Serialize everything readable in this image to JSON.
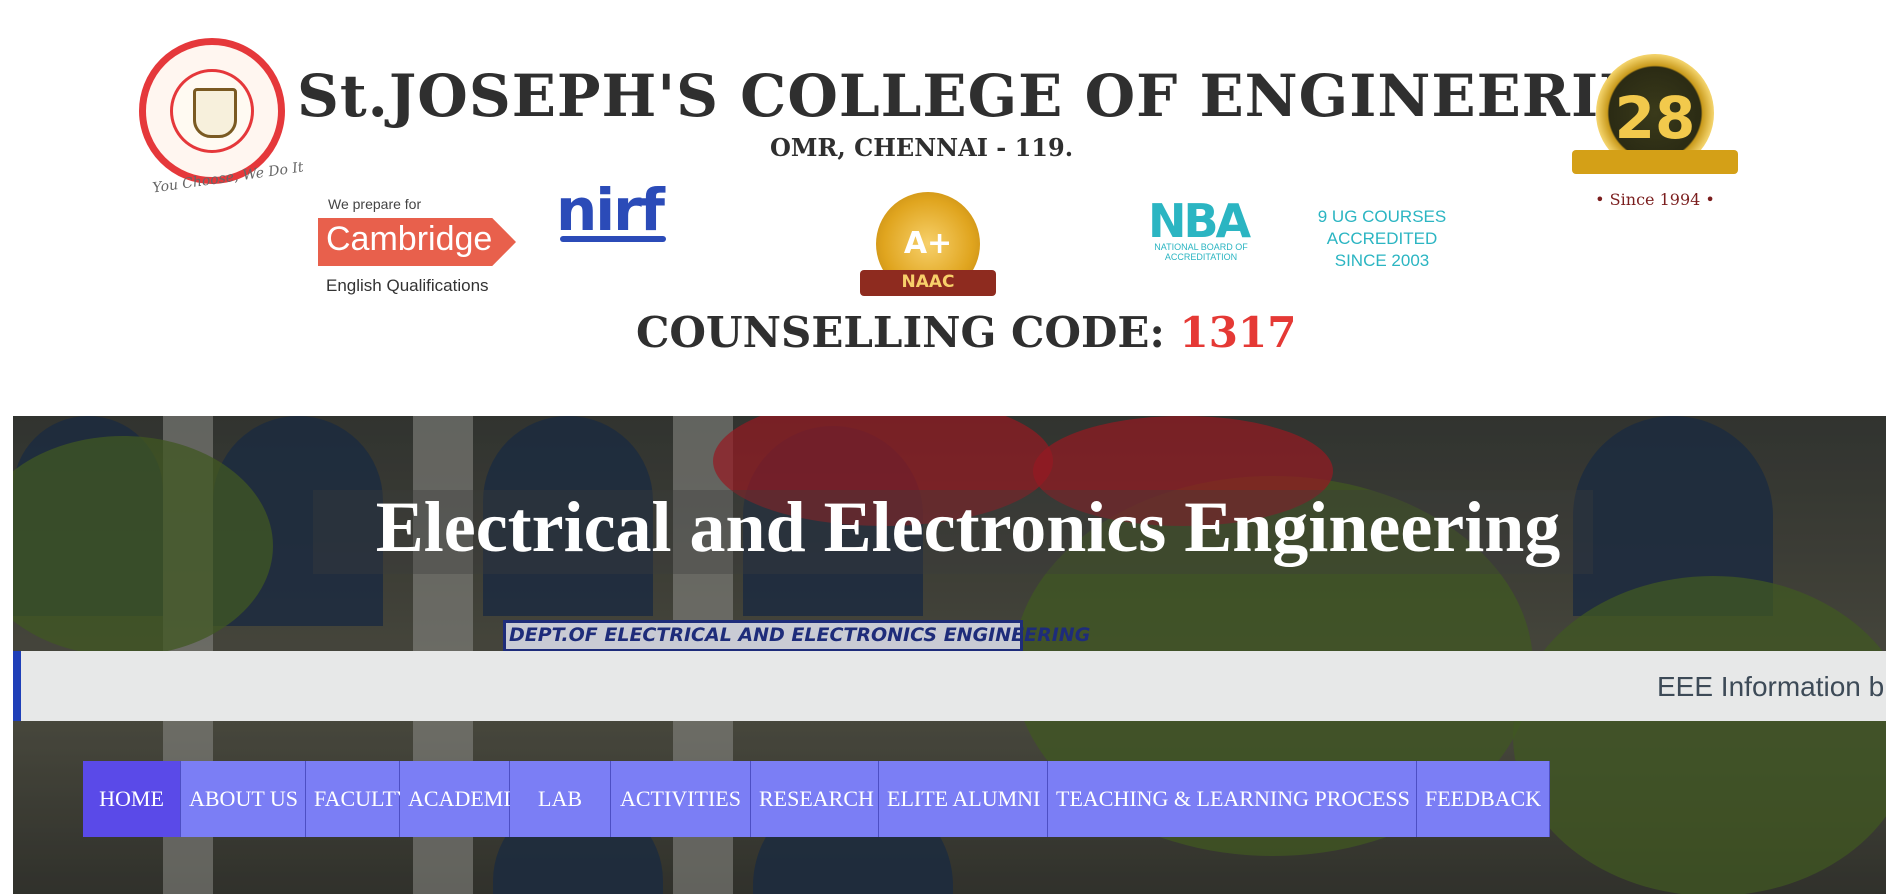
{
  "header": {
    "college_name": "St.JOSEPH'S COLLEGE OF ENGINEERING",
    "college_address": "OMR, CHENNAI -  119.",
    "seal_motto": "You Choose, We Do It",
    "anniversary_number": "28",
    "anniversary_since": "• Since 1994 •",
    "cambridge_pre": "We prepare for",
    "cambridge_name": "Cambridge",
    "cambridge_post": "English Qualifications",
    "nirf": "nirf",
    "naac_grade": "A+",
    "naac_name": "NAAC",
    "nba_logo": "NBA",
    "nba_sub": "NATIONAL BOARD OF ACCREDITATION",
    "nba_text_line1": "9 UG COURSES ACCREDITED",
    "nba_text_line2": "SINCE 2003",
    "counselling_label": "COUNSELLING CODE: ",
    "counselling_code": "1317"
  },
  "hero": {
    "title": "Electrical and Electronics Engineering",
    "sign_text": "DEPT.OF ELECTRICAL AND ELECTRONICS ENGINEERING",
    "ticker_text": "EEE Information b"
  },
  "nav": {
    "items": [
      {
        "label": "HOME",
        "active": true
      },
      {
        "label": "ABOUT US",
        "active": false
      },
      {
        "label": "FACULTY",
        "active": false
      },
      {
        "label": "ACADEMIC",
        "active": false
      },
      {
        "label": "LAB",
        "active": false
      },
      {
        "label": "ACTIVITIES",
        "active": false
      },
      {
        "label": "RESEARCH",
        "active": false
      },
      {
        "label": "ELITE ALUMNI",
        "active": false
      },
      {
        "label": "TEACHING & LEARNING PROCESS",
        "active": false
      },
      {
        "label": "FEEDBACK",
        "active": false
      }
    ]
  },
  "colors": {
    "nav_bg": "#7b7ef5",
    "nav_active": "#5a4ae8",
    "ticker_accent": "#1f3fb8",
    "counselling_code": "#e53935"
  }
}
